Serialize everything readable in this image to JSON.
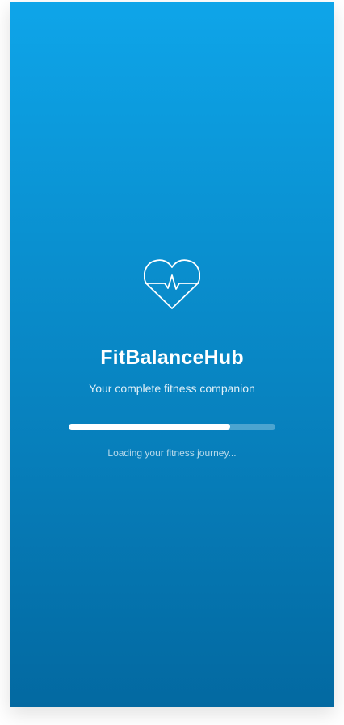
{
  "app": {
    "name": "FitBalanceHub",
    "tagline": "Your complete fitness companion"
  },
  "logo": {
    "icon": "heart-pulse-icon",
    "color": "#ffffff"
  },
  "loading": {
    "progress": 0.78,
    "message": "Loading your fitness journey..."
  },
  "theme": {
    "gradient_top": "#0ea5e9",
    "gradient_bottom": "#0369a1"
  }
}
